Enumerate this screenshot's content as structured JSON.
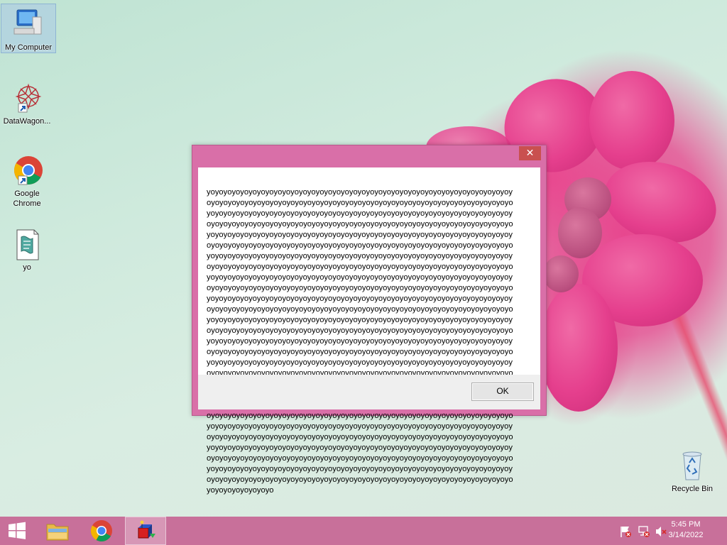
{
  "desktop": {
    "icons": [
      {
        "label": "My Computer",
        "icon": "computer-icon"
      },
      {
        "label": "DataWagon...",
        "icon": "datawagon-icon"
      },
      {
        "label": "Google Chrome",
        "icon": "chrome-icon"
      },
      {
        "label": "yo",
        "icon": "script-file-icon"
      },
      {
        "label": "Recycle Bin",
        "icon": "recycle-bin-icon"
      }
    ]
  },
  "dialog": {
    "close_glyph": "✕",
    "message": "yoyoyoyoyoyoyoyoyoyoyoyoyoyoyoyoyoyoyoyoyoyoyoyoyoyoyoyoyoyoyoyoyoyoyoyoyoyoyoyoyoyoyoyoyoyoyoyoyoyoyoyoyoyoyoyoyoyoyoyoyoyoyoyoyoyoyoyoyoyoyoyoyoyoyoyoyoyoyoyoyoyoyoyoyoyoyoyoyoyoyoyoyoyoyoyoyoyoyoyoyoyoyoyoyoyoyoyoyoyoyoyoyoyoyoyoyoyoyoyoyoyoyoyoyoyoyoyoyoyoyoyoyoyoyoyoyoyoyoyoyoyoyoyoyoyoyoyoyoyoyoyoyoyoyoyoyoyoyoyoyoyoyoyoyoyoyoyoyoyoyoyoyoyoyoyoyoyoyoyoyoyoyoyoyoyoyoyoyoyoyoyoyoyoyoyoyoyoyoyoyoyoyoyoyoyoyoyoyoyoyoyoyoyoyoyoyoyoyoyoyoyoyoyoyoyoyoyoyoyoyoyoyoyoyoyoyoyoyoyoyoyoyoyoyoyoyoyoyoyoyoyoyoyoyoyoyoyoyoyoyoyoyoyoyoyoyoyoyoyoyoyoyoyoyoyoyoyoyoyoyoyoyoyoyoyoyoyoyoyoyoyoyoyoyoyoyoyoyoyoyoyoyoyoyoyoyoyoyoyoyoyoyoyoyoyoyoyoyoyoyoyoyoyoyoyoyoyoyoyoyoyoyoyoyoyoyoyoyoyoyoyoyoyoyoyoyoyoyoyoyoyoyoyoyoyoyoyoyoyoyoyoyoyoyoyoyoyoyoyoyoyoyoyoyoyoyoyoyoyoyoyoyoyoyoyoyoyoyoyoyoyoyoyoyoyoyoyoyoyoyoyoyoyoyoyoyoyoyoyoyoyoyoyoyoyoyoyoyoyoyoyoyoyoyoyoyoyoyoyoyoyoyoyoyoyoyoyoyoyoyoyoyoyoyoyoyoyoyoyoyoyoyoyoyoyoyoyoyoyoyoyoyoyoyoyoyoyoyoyoyoyoyoyoyoyoyoyoyoyoyoyoyoyoyoyoyoyoyoyoyoyoyoyoyoyoyoyoyoyoyoyoyoyoyoyoyoyoyoyoyoyoyoyoyoyoyoyoyoyoyoyoyoyoyoyoyoyoyoyoyoyoyoyoyoyoyoyoyoyoyoyoyoyoyoyoyoyoyoyoyoyoyoyoyoyoyoyoyoyoyoyoyoyoyoyoyoyoyoyoyoyoyoyoyoyoyoyoyoyoyoyoyoyoyoyoyoyoyoyoyoyoyoyoyoyoyoyoyoyoyoyoyoyoyoyoyoyoyoyoyoyoyoyoyoyoyoyoyoyoyoyoyoyoyoyoyoyoyoyoyoyoyoyoyoyoyoyoyoyoyoyoyoyoyoyoyoyoyoyoyoyoyoyoyoyoyoyoyoyoyoyoyoyoyoyoyoyoyoyoyoyoyoyoyoyoyoyoyoyoyoyoyoyoyoyoyoyoyoyoyoyoyoyoyoyoyoyoyoyoyoyoyoyoyoyoyoyoyoyoyoyoyoyoyoyoyoyoyoyoyoyoyoyoyoyoyoyoyoyoyoyoyoyoyoyoyoyoyoyoyoyoyoyoyoyoyoyoyoyoyoyoyoyoyoyoyoyoyoyoyoyoyoyoyoyoyoyoyoyoyoyoyoyoyoyoyoyoyoyoyoyoyoyoyoyoyoyoyoyoyoyoyoyoyoyoyoyoyoyoyoyoyoyoyoyoyoyoyoyoyoyoyoyoyoyoyoyoyoyoyoyoyoyoyoyoyoyoyoyoyoyoyoyoyoyoyoyoyoyoyoyoyoyoyoyoyoyoyoyoyoyoyoyoyoyoyoyoyoyoyoyoyoyoyoyoyoyoyoyoyoyoyoyoyoyoyoyoyoyoyoyoyoyoyoyoyoyoyoyoyoyoyoyoyoyoyoyoyoyoyoyoyoyoyoyoyoyoyoyoyoyoyoyoyoyoyoyoyoyoyoyoyoyoyoyoyoyoyoyoyoyoyoyoyoyoyoyoyoyoyoyoyoyoyoyoyoyoyoyoyoyoyoyoyoyoyoyoyoyoyoyoyoyoyoyoyoyoyoyoyoyoyoyoyoyoyoyoyoyoyoyoyoyoyoyoyoyoyoyoyoyoyoyoyoyoyoyoyoyoyoyoyoyoyoyoyoyoyoyoyoyoyoyoyoyoyoyoyoyoyoyoyoyoyoyoyoyoyoyo",
    "ok_label": "OK"
  },
  "taskbar": {
    "start_icon": "windows-start-icon",
    "pinned": [
      {
        "name": "file-explorer",
        "icon": "folder-icon"
      },
      {
        "name": "google-chrome",
        "icon": "chrome-icon"
      },
      {
        "name": "active-app",
        "icon": "app-icon",
        "active": true
      }
    ],
    "tray": [
      {
        "icon": "flag-alert-icon"
      },
      {
        "icon": "network-icon"
      },
      {
        "icon": "volume-muted-icon"
      }
    ],
    "clock": {
      "time": "5:45 PM",
      "date": "3/14/2022"
    }
  },
  "colors": {
    "taskbar": "#c8709a",
    "dialog_frame": "#d96fa8",
    "close_button": "#c9504f"
  }
}
